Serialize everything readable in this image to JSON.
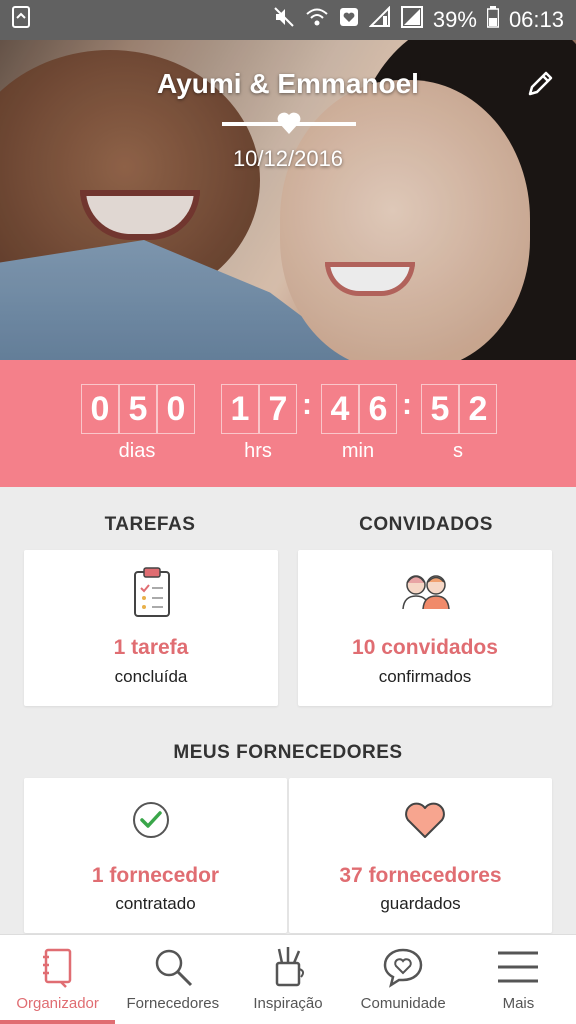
{
  "status_bar": {
    "battery": "39%",
    "time": "06:13"
  },
  "couple": {
    "names": "Ayumi & Emmanoel",
    "date": "10/12/2016"
  },
  "countdown": {
    "days": [
      "0",
      "5",
      "0"
    ],
    "hours": [
      "1",
      "7"
    ],
    "minutes": [
      "4",
      "6"
    ],
    "seconds": [
      "5",
      "2"
    ],
    "labels": {
      "days": "dias",
      "hours": "hrs",
      "minutes": "min",
      "seconds": "s"
    }
  },
  "tasks": {
    "title": "TAREFAS",
    "count": "1 tarefa",
    "status": "concluída"
  },
  "guests": {
    "title": "CONVIDADOS",
    "count": "10 convidados",
    "status": "confirmados"
  },
  "vendors": {
    "title": "MEUS FORNECEDORES",
    "hired": {
      "count": "1 fornecedor",
      "status": "contratado"
    },
    "saved": {
      "count": "37 fornecedores",
      "status": "guardados"
    }
  },
  "nav": {
    "items": [
      {
        "label": "Organizador",
        "icon": "notebook-icon",
        "active": true
      },
      {
        "label": "Fornecedores",
        "icon": "search-icon",
        "active": false
      },
      {
        "label": "Inspiração",
        "icon": "pencil-cup-icon",
        "active": false
      },
      {
        "label": "Comunidade",
        "icon": "chat-heart-icon",
        "active": false
      },
      {
        "label": "Mais",
        "icon": "menu-icon",
        "active": false
      }
    ]
  },
  "colors": {
    "accent": "#f4808a",
    "accent_text": "#e06d72",
    "status_bar": "#616161"
  }
}
